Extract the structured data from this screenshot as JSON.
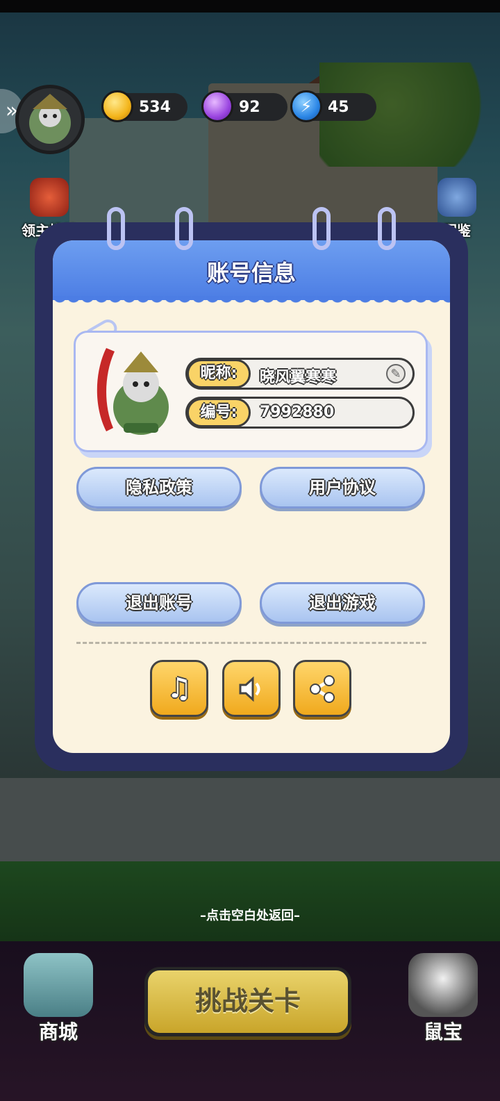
{
  "header": {
    "currencies": [
      {
        "name": "coin",
        "value": "534"
      },
      {
        "name": "gem",
        "value": "92"
      },
      {
        "name": "energy",
        "value": "45"
      }
    ]
  },
  "side": {
    "left_label": "领主挑战",
    "right_label": "图鉴"
  },
  "dialog": {
    "title": "账号信息",
    "nickname_label": "昵称:",
    "nickname_value": "晓风翼寒寒",
    "id_label": "编号:",
    "id_value": "7992880",
    "buttons": {
      "privacy": "隐私政策",
      "agreement": "用户协议",
      "logout": "退出账号",
      "exit": "退出游戏"
    },
    "icon_buttons": [
      "music-icon",
      "sound-icon",
      "share-icon"
    ]
  },
  "hint": "–点击空白处返回–",
  "bottom_nav": {
    "shop": "商城",
    "challenge": "挑战关卡",
    "treasure": "鼠宝"
  },
  "colors": {
    "dialog_frame": "#2a2f5e",
    "dialog_header": "#4c7de4",
    "accent_yellow": "#f9d367",
    "button_blue": "#a9c4f0"
  }
}
